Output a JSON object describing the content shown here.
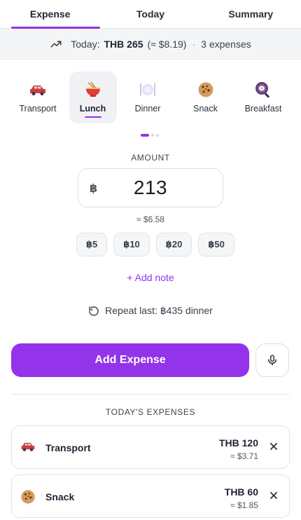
{
  "tabs": [
    "Expense",
    "Today",
    "Summary"
  ],
  "summary": {
    "prefix": "Today:",
    "total": "THB 265",
    "approx": "(≈ $8.19)",
    "separator": "·",
    "count": "3 expenses"
  },
  "categories": [
    {
      "label": "Transport",
      "icon": "car-icon"
    },
    {
      "label": "Lunch",
      "icon": "noodle-bowl-icon"
    },
    {
      "label": "Dinner",
      "icon": "plate-icon"
    },
    {
      "label": "Snack",
      "icon": "cookie-icon"
    },
    {
      "label": "Breakfast",
      "icon": "frying-pan-icon"
    }
  ],
  "amount": {
    "label": "AMOUNT",
    "currency_symbol": "฿",
    "value": "213",
    "approx": "≈ $6.58"
  },
  "quick_amounts": [
    "฿5",
    "฿10",
    "฿20",
    "฿50"
  ],
  "add_note": "+ Add note",
  "repeat_last": "Repeat last: ฿435 dinner",
  "add_button": "Add Expense",
  "today_expenses": {
    "label": "TODAY'S EXPENSES",
    "items": [
      {
        "name": "Transport",
        "amount": "THB 120",
        "usd": "≈ $3.71",
        "icon": "car-icon"
      },
      {
        "name": "Snack",
        "amount": "THB 60",
        "usd": "≈ $1.85",
        "icon": "cookie-icon"
      }
    ]
  },
  "colors": {
    "accent": "#9333ea",
    "surface": "#f4f5f7",
    "border": "#e2e4e9"
  }
}
